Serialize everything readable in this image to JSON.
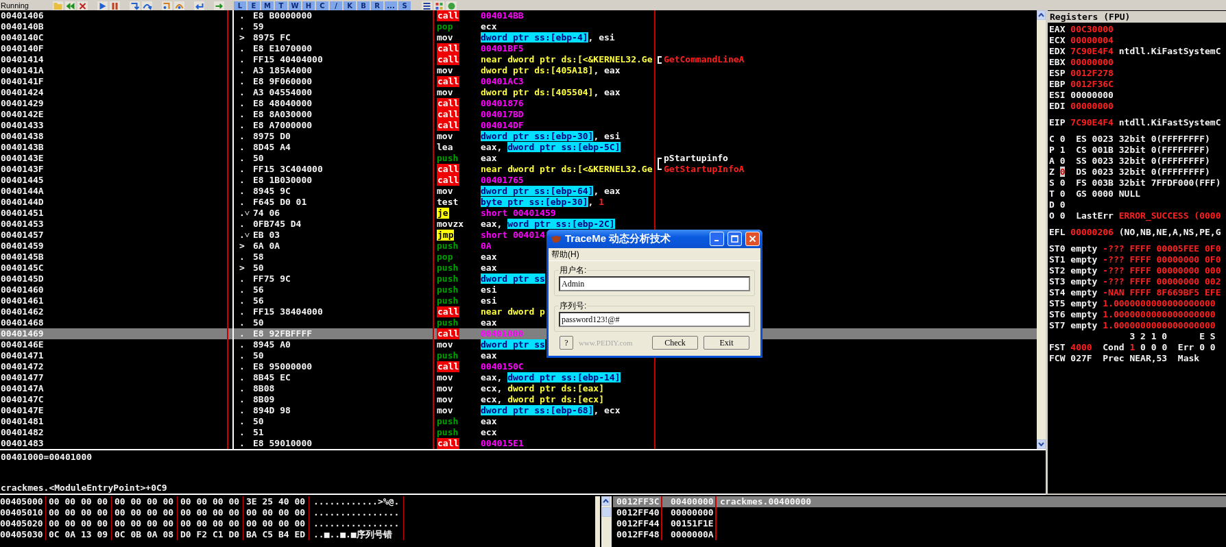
{
  "toolbar": {
    "status": "Running",
    "buttons": [
      "L",
      "E",
      "M",
      "T",
      "W",
      "H",
      "C",
      "/",
      "K",
      "B",
      "R",
      "...",
      "S"
    ]
  },
  "disassembly": {
    "rows": [
      {
        "address": "00401406",
        "marker": ".",
        "hex": "E8 B0000000",
        "mnemonic": "call",
        "kind": "call",
        "operand": [
          {
            "text": "004014BB",
            "kind": "target"
          }
        ],
        "selected": false
      },
      {
        "address": "0040140B",
        "marker": ".",
        "hex": "59",
        "mnemonic": "pop",
        "kind": "stack",
        "operand": [
          {
            "text": "ecx",
            "kind": "plain"
          }
        ],
        "selected": false
      },
      {
        "address": "0040140C",
        "marker": ">",
        "hex": "8975 FC",
        "mnemonic": "mov",
        "kind": "plain",
        "operand": [
          {
            "text": "dword ptr ss:[ebp-4]",
            "kind": "mem"
          },
          {
            "text": ", esi",
            "kind": "plain"
          }
        ],
        "selected": false
      },
      {
        "address": "0040140F",
        "marker": ".",
        "hex": "E8 E1070000",
        "mnemonic": "call",
        "kind": "call",
        "operand": [
          {
            "text": "00401BF5",
            "kind": "target"
          }
        ],
        "selected": false
      },
      {
        "address": "00401414",
        "marker": ".",
        "hex": "FF15 40404000",
        "mnemonic": "call",
        "kind": "call",
        "operand": [
          {
            "text": "near dword ptr ds:[<&KERNEL32.Ge",
            "kind": "const"
          }
        ],
        "comment": {
          "text": "GetCommandLineA",
          "kind": "api"
        },
        "selected": false
      },
      {
        "address": "0040141A",
        "marker": ".",
        "hex": "A3 185A4000",
        "mnemonic": "mov",
        "kind": "plain",
        "operand": [
          {
            "text": "dword ptr ds:[405A18]",
            "kind": "const"
          },
          {
            "text": ", eax",
            "kind": "plain"
          }
        ],
        "selected": false
      },
      {
        "address": "0040141F",
        "marker": ".",
        "hex": "E8 9F060000",
        "mnemonic": "call",
        "kind": "call",
        "operand": [
          {
            "text": "00401AC3",
            "kind": "target"
          }
        ],
        "selected": false
      },
      {
        "address": "00401424",
        "marker": ".",
        "hex": "A3 04554000",
        "mnemonic": "mov",
        "kind": "plain",
        "operand": [
          {
            "text": "dword ptr ds:[405504]",
            "kind": "const"
          },
          {
            "text": ", eax",
            "kind": "plain"
          }
        ],
        "selected": false
      },
      {
        "address": "00401429",
        "marker": ".",
        "hex": "E8 48040000",
        "mnemonic": "call",
        "kind": "call",
        "operand": [
          {
            "text": "00401876",
            "kind": "target"
          }
        ],
        "selected": false
      },
      {
        "address": "0040142E",
        "marker": ".",
        "hex": "E8 8A030000",
        "mnemonic": "call",
        "kind": "call",
        "operand": [
          {
            "text": "004017BD",
            "kind": "target"
          }
        ],
        "selected": false
      },
      {
        "address": "00401433",
        "marker": ".",
        "hex": "E8 A7000000",
        "mnemonic": "call",
        "kind": "call",
        "operand": [
          {
            "text": "004014DF",
            "kind": "target"
          }
        ],
        "selected": false
      },
      {
        "address": "00401438",
        "marker": ".",
        "hex": "8975 D0",
        "mnemonic": "mov",
        "kind": "plain",
        "operand": [
          {
            "text": "dword ptr ss:[ebp-30]",
            "kind": "mem"
          },
          {
            "text": ", esi",
            "kind": "plain"
          }
        ],
        "selected": false
      },
      {
        "address": "0040143B",
        "marker": ".",
        "hex": "8D45 A4",
        "mnemonic": "lea",
        "kind": "plain",
        "operand": [
          {
            "text": "eax, ",
            "kind": "plain"
          },
          {
            "text": "dword ptr ss:[ebp-5C]",
            "kind": "mem"
          }
        ],
        "selected": false
      },
      {
        "address": "0040143E",
        "marker": ".",
        "hex": "50",
        "mnemonic": "push",
        "kind": "stack",
        "operand": [
          {
            "text": "eax",
            "kind": "plain"
          }
        ],
        "comment": {
          "text": "pStartupinfo",
          "kind": "arg"
        },
        "selected": false
      },
      {
        "address": "0040143F",
        "marker": ".",
        "hex": "FF15 3C404000",
        "mnemonic": "call",
        "kind": "call",
        "operand": [
          {
            "text": "near dword ptr ds:[<&KERNEL32.Ge",
            "kind": "const"
          }
        ],
        "comment": {
          "text": "GetStartupInfoA",
          "kind": "api"
        },
        "selected": false
      },
      {
        "address": "00401445",
        "marker": ".",
        "hex": "E8 1B030000",
        "mnemonic": "call",
        "kind": "call",
        "operand": [
          {
            "text": "00401765",
            "kind": "target"
          }
        ],
        "selected": false
      },
      {
        "address": "0040144A",
        "marker": ".",
        "hex": "8945 9C",
        "mnemonic": "mov",
        "kind": "plain",
        "operand": [
          {
            "text": "dword ptr ss:[ebp-64]",
            "kind": "mem"
          },
          {
            "text": ", eax",
            "kind": "plain"
          }
        ],
        "selected": false
      },
      {
        "address": "0040144D",
        "marker": ".",
        "hex": "F645 D0 01",
        "mnemonic": "test",
        "kind": "plain",
        "operand": [
          {
            "text": "byte ptr ss:[ebp-30]",
            "kind": "mem"
          },
          {
            "text": ", ",
            "kind": "plain"
          },
          {
            "text": "1",
            "kind": "num"
          }
        ],
        "selected": false
      },
      {
        "address": "00401451",
        "marker": ".˅",
        "hex": "74 06",
        "mnemonic": "je",
        "kind": "jump",
        "operand": [
          {
            "text": "short 00401459",
            "kind": "target"
          }
        ],
        "selected": false
      },
      {
        "address": "00401453",
        "marker": ".",
        "hex": "0FB745 D4",
        "mnemonic": "movzx",
        "kind": "plain",
        "operand": [
          {
            "text": "eax, ",
            "kind": "plain"
          },
          {
            "text": "word ptr ss:[ebp-2C]",
            "kind": "mem"
          }
        ],
        "selected": false
      },
      {
        "address": "00401457",
        "marker": ".˅",
        "hex": "EB 03",
        "mnemonic": "jmp",
        "kind": "jump",
        "operand": [
          {
            "text": "short 004014",
            "kind": "target"
          }
        ],
        "selected": false
      },
      {
        "address": "00401459",
        "marker": ">",
        "hex": "6A 0A",
        "mnemonic": "push",
        "kind": "stack",
        "operand": [
          {
            "text": "0A",
            "kind": "target"
          }
        ],
        "selected": false
      },
      {
        "address": "0040145B",
        "marker": ".",
        "hex": "58",
        "mnemonic": "pop",
        "kind": "stack",
        "operand": [
          {
            "text": "eax",
            "kind": "plain"
          }
        ],
        "selected": false
      },
      {
        "address": "0040145C",
        "marker": ">",
        "hex": "50",
        "mnemonic": "push",
        "kind": "stack",
        "operand": [
          {
            "text": "eax",
            "kind": "plain"
          }
        ],
        "selected": false
      },
      {
        "address": "0040145D",
        "marker": ".",
        "hex": "FF75 9C",
        "mnemonic": "push",
        "kind": "stack",
        "operand": [
          {
            "text": "dword ptr ss",
            "kind": "mem"
          }
        ],
        "selected": false
      },
      {
        "address": "00401460",
        "marker": ".",
        "hex": "56",
        "mnemonic": "push",
        "kind": "stack",
        "operand": [
          {
            "text": "esi",
            "kind": "plain"
          }
        ],
        "selected": false
      },
      {
        "address": "00401461",
        "marker": ".",
        "hex": "56",
        "mnemonic": "push",
        "kind": "stack",
        "operand": [
          {
            "text": "esi",
            "kind": "plain"
          }
        ],
        "selected": false
      },
      {
        "address": "00401462",
        "marker": ".",
        "hex": "FF15 38404000",
        "mnemonic": "call",
        "kind": "call",
        "operand": [
          {
            "text": "near dword p",
            "kind": "const"
          }
        ],
        "selected": false
      },
      {
        "address": "00401468",
        "marker": ".",
        "hex": "50",
        "mnemonic": "push",
        "kind": "stack",
        "operand": [
          {
            "text": "eax",
            "kind": "plain"
          }
        ],
        "selected": false
      },
      {
        "address": "00401469",
        "marker": ".",
        "hex": "E8 92FBFFFF",
        "mnemonic": "call",
        "kind": "call",
        "operand": [
          {
            "text": "00401000",
            "kind": "target"
          }
        ],
        "selected": true
      },
      {
        "address": "0040146E",
        "marker": ".",
        "hex": "8945 A0",
        "mnemonic": "mov",
        "kind": "plain",
        "operand": [
          {
            "text": "dword ptr ss",
            "kind": "mem"
          }
        ],
        "selected": false
      },
      {
        "address": "00401471",
        "marker": ".",
        "hex": "50",
        "mnemonic": "push",
        "kind": "stack",
        "operand": [
          {
            "text": "eax",
            "kind": "plain"
          }
        ],
        "selected": false
      },
      {
        "address": "00401472",
        "marker": ".",
        "hex": "E8 95000000",
        "mnemonic": "call",
        "kind": "call",
        "operand": [
          {
            "text": "0040150C",
            "kind": "target"
          }
        ],
        "selected": false
      },
      {
        "address": "00401477",
        "marker": ".",
        "hex": "8B45 EC",
        "mnemonic": "mov",
        "kind": "plain",
        "operand": [
          {
            "text": "eax, ",
            "kind": "plain"
          },
          {
            "text": "dword ptr ss:[ebp-14]",
            "kind": "mem"
          }
        ],
        "selected": false
      },
      {
        "address": "0040147A",
        "marker": ".",
        "hex": "8B08",
        "mnemonic": "mov",
        "kind": "plain",
        "operand": [
          {
            "text": "ecx, ",
            "kind": "plain"
          },
          {
            "text": "dword ptr ds:[eax]",
            "kind": "const"
          }
        ],
        "selected": false
      },
      {
        "address": "0040147C",
        "marker": ".",
        "hex": "8B09",
        "mnemonic": "mov",
        "kind": "plain",
        "operand": [
          {
            "text": "ecx, ",
            "kind": "plain"
          },
          {
            "text": "dword ptr ds:[ecx]",
            "kind": "const"
          }
        ],
        "selected": false
      },
      {
        "address": "0040147E",
        "marker": ".",
        "hex": "894D 98",
        "mnemonic": "mov",
        "kind": "plain",
        "operand": [
          {
            "text": "dword ptr ss:[ebp-68]",
            "kind": "mem"
          },
          {
            "text": ", ecx",
            "kind": "plain"
          }
        ],
        "selected": false
      },
      {
        "address": "00401481",
        "marker": ".",
        "hex": "50",
        "mnemonic": "push",
        "kind": "stack",
        "operand": [
          {
            "text": "eax",
            "kind": "plain"
          }
        ],
        "selected": false
      },
      {
        "address": "00401482",
        "marker": ".",
        "hex": "51",
        "mnemonic": "push",
        "kind": "stack",
        "operand": [
          {
            "text": "ecx",
            "kind": "plain"
          }
        ],
        "selected": false
      },
      {
        "address": "00401483",
        "marker": ".",
        "hex": "E8 59010000",
        "mnemonic": "call",
        "kind": "call",
        "operand": [
          {
            "text": "004015E1",
            "kind": "target"
          }
        ],
        "selected": false
      }
    ]
  },
  "info": {
    "lines": [
      "00401000=00401000",
      "crackmes.<ModuleEntryPoint>+0C9"
    ]
  },
  "registers": {
    "title": "Registers (FPU)",
    "groups": [
      [
        [
          {
            "text": "EAX ",
            "kind": "plain"
          },
          {
            "text": "00C30000",
            "kind": "changed"
          }
        ],
        [
          {
            "text": "ECX ",
            "kind": "plain"
          },
          {
            "text": "00000004",
            "kind": "changed"
          }
        ],
        [
          {
            "text": "EDX ",
            "kind": "plain"
          },
          {
            "text": "7C90E4F4",
            "kind": "changed"
          },
          {
            "text": " ntdll.KiFastSystemC",
            "kind": "plain"
          }
        ],
        [
          {
            "text": "EBX ",
            "kind": "plain"
          },
          {
            "text": "00000000",
            "kind": "changed"
          }
        ],
        [
          {
            "text": "ESP ",
            "kind": "plain"
          },
          {
            "text": "0012F278",
            "kind": "changed"
          }
        ],
        [
          {
            "text": "EBP ",
            "kind": "plain"
          },
          {
            "text": "0012F36C",
            "kind": "changed"
          }
        ],
        [
          {
            "text": "ESI 00000000",
            "kind": "plain"
          }
        ],
        [
          {
            "text": "EDI ",
            "kind": "plain"
          },
          {
            "text": "00000000",
            "kind": "changed"
          }
        ]
      ],
      [
        [
          {
            "text": "EIP ",
            "kind": "plain"
          },
          {
            "text": "7C90E4F4",
            "kind": "changed"
          },
          {
            "text": " ntdll.KiFastSystemC",
            "kind": "plain"
          }
        ]
      ],
      [
        [
          {
            "text": "C 0  ES 0023 32bit 0(FFFFFFFF)",
            "kind": "plain"
          }
        ],
        [
          {
            "text": "P 1  CS 001B 32bit 0(FFFFFFFF)",
            "kind": "plain"
          }
        ],
        [
          {
            "text": "A 0  SS 0023 32bit 0(FFFFFFFF)",
            "kind": "plain"
          }
        ],
        [
          {
            "text": "Z ",
            "kind": "plain"
          },
          {
            "text": "0",
            "kind": "boxed"
          },
          {
            "text": "  DS 0023 32bit 0(FFFFFFFF)",
            "kind": "plain"
          }
        ],
        [
          {
            "text": "S 0  FS 003B 32bit 7FFDF000(FFF)",
            "kind": "plain"
          }
        ],
        [
          {
            "text": "T 0  GS 0000 NULL",
            "kind": "plain"
          }
        ],
        [
          {
            "text": "D 0",
            "kind": "plain"
          }
        ],
        [
          {
            "text": "O 0  LastErr ",
            "kind": "plain"
          },
          {
            "text": "ERROR_SUCCESS (0000",
            "kind": "changed"
          }
        ]
      ],
      [
        [
          {
            "text": "EFL ",
            "kind": "plain"
          },
          {
            "text": "00000206",
            "kind": "changed"
          },
          {
            "text": " (NO,NB,NE,A,NS,PE,G",
            "kind": "plain"
          }
        ]
      ],
      [
        [
          {
            "text": "ST0 empty ",
            "kind": "plain"
          },
          {
            "text": "-??? FFFF 00005FEE 0F0",
            "kind": "changed"
          }
        ],
        [
          {
            "text": "ST1 empty ",
            "kind": "plain"
          },
          {
            "text": "-??? FFFF 00000000 0F0",
            "kind": "changed"
          }
        ],
        [
          {
            "text": "ST2 empty ",
            "kind": "plain"
          },
          {
            "text": "-??? FFFF 00000000 000",
            "kind": "changed"
          }
        ],
        [
          {
            "text": "ST3 empty ",
            "kind": "plain"
          },
          {
            "text": "-??? FFFF 00000000 002",
            "kind": "changed"
          }
        ],
        [
          {
            "text": "ST4 empty ",
            "kind": "plain"
          },
          {
            "text": "-NAN FFFF 8F669BF5 EFE",
            "kind": "changed"
          }
        ],
        [
          {
            "text": "ST5 empty ",
            "kind": "plain"
          },
          {
            "text": "1.0000000000000000000",
            "kind": "changed"
          }
        ],
        [
          {
            "text": "ST6 empty ",
            "kind": "plain"
          },
          {
            "text": "1.0000000000000000000",
            "kind": "changed"
          }
        ],
        [
          {
            "text": "ST7 empty ",
            "kind": "plain"
          },
          {
            "text": "1.0000000000000000000",
            "kind": "changed"
          }
        ],
        [
          {
            "text": "               3 2 1 0      E S",
            "kind": "plain"
          }
        ],
        [
          {
            "text": "FST ",
            "kind": "plain"
          },
          {
            "text": "4000",
            "kind": "changed"
          },
          {
            "text": "  Cond ",
            "kind": "plain"
          },
          {
            "text": "1",
            "kind": "changed"
          },
          {
            "text": " 0 0 0  Err 0 0",
            "kind": "plain"
          }
        ],
        [
          {
            "text": "FCW 027F  Prec NEAR,53  Mask",
            "kind": "plain"
          }
        ]
      ]
    ]
  },
  "dump": {
    "rows": [
      {
        "address": "00405000",
        "groups": [
          "00 00 00 00",
          "00 00 00 00",
          "00 00 00 00",
          "3E 25 40 00"
        ],
        "ascii": "............>%@."
      },
      {
        "address": "00405010",
        "groups": [
          "00 00 00 00",
          "00 00 00 00",
          "00 00 00 00",
          "00 00 00 00"
        ],
        "ascii": "................"
      },
      {
        "address": "00405020",
        "groups": [
          "00 00 00 00",
          "00 00 00 00",
          "00 00 00 00",
          "00 00 00 00"
        ],
        "ascii": "................"
      },
      {
        "address": "00405030",
        "groups": [
          "0C 0A 13 09",
          "0C 0B 0A 08",
          "D0 F2 C1 D0",
          "BA C5 B4 ED"
        ],
        "ascii": "..■..■.■序列号错"
      }
    ]
  },
  "stack": {
    "rows": [
      {
        "address": "0012FF3C",
        "value": "00400000",
        "comment": "crackmes.00400000",
        "selected": true
      },
      {
        "address": "0012FF40",
        "value": "00000000",
        "selected": false
      },
      {
        "address": "0012FF44",
        "value": "00151F1E",
        "selected": false
      },
      {
        "address": "0012FF48",
        "value": "0000000A",
        "selected": false
      }
    ]
  },
  "dialog": {
    "title": "TraceMe 动态分析技术",
    "menu": [
      "帮助(H)"
    ],
    "fields": [
      {
        "label": "用户名:",
        "value": "Admin"
      },
      {
        "label": "序列号:",
        "value": "password123!@#"
      }
    ],
    "help_button": "?",
    "watermark": "www.PEDIY.com",
    "buttons": [
      "Check",
      "Exit"
    ]
  }
}
